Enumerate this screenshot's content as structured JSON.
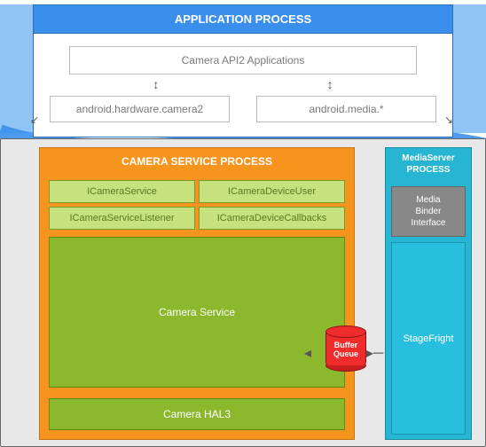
{
  "app_process": {
    "title": "APPLICATION PROCESS",
    "api_apps": "Camera API2 Applications",
    "lib_left": "android.hardware.camera2",
    "lib_right": "android.media.*"
  },
  "camera_service_process": {
    "title": "CAMERA SERVICE PROCESS",
    "aidl": {
      "a": "ICameraService",
      "b": "ICameraDeviceUser",
      "c": "ICameraServiceListener",
      "d": "ICameraDeviceCallbacks"
    },
    "service": "Camera Service",
    "hal": "Camera HAL3"
  },
  "media_server_process": {
    "title_line1": "MediaServer",
    "title_line2": "PROCESS",
    "binder": "Media\nBinder\nInterface",
    "stagefright": "StageFright"
  },
  "buffer_queue": "Buffer\nQueue",
  "colors": {
    "blue": "#3b8fec",
    "orange": "#f7941e",
    "green": "#8cb82e",
    "lightgreen": "#c6e27f",
    "cyan": "#26b6d4",
    "gray": "#888888",
    "red": "#ef2b2b"
  }
}
